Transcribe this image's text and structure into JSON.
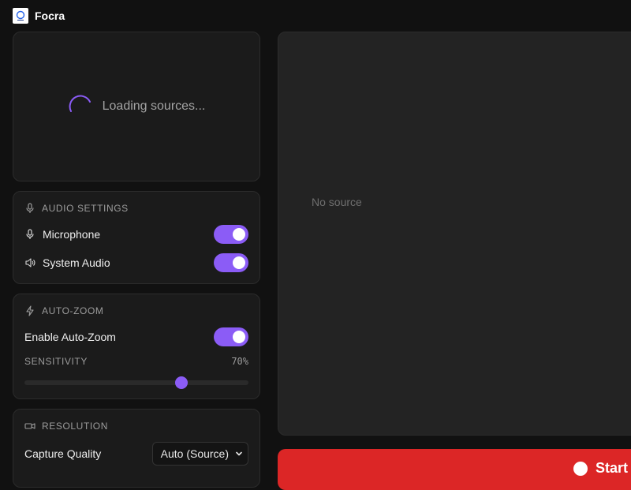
{
  "app": {
    "title": "Focra",
    "logo_icon": "focra-logo-icon"
  },
  "sources": {
    "loading_text": "Loading sources..."
  },
  "audio": {
    "title": "AUDIO SETTINGS",
    "microphone": {
      "label": "Microphone",
      "enabled": true
    },
    "system_audio": {
      "label": "System Audio",
      "enabled": true
    }
  },
  "autozoom": {
    "title": "AUTO-ZOOM",
    "enable": {
      "label": "Enable Auto-Zoom",
      "enabled": true
    },
    "sensitivity": {
      "label": "SENSITIVITY",
      "value_text": "70%",
      "value": 70
    }
  },
  "resolution": {
    "title": "RESOLUTION",
    "quality_label": "Capture Quality",
    "selected": "Auto (Source)"
  },
  "preview": {
    "empty_text": "No source"
  },
  "record": {
    "label": "Start"
  },
  "colors": {
    "accent": "#8b5cf6",
    "record": "#dc2626",
    "background": "#111111",
    "card": "#1b1b1b"
  }
}
